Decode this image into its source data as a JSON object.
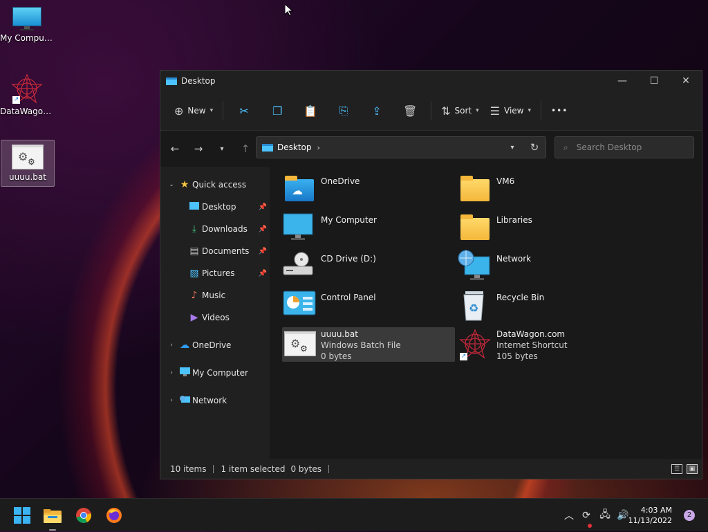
{
  "desktop": {
    "icons": [
      {
        "label": "My Computer",
        "icon": "monitor-icon"
      },
      {
        "label": "DataWagon...",
        "icon": "datawagon-icon"
      },
      {
        "label": "uuuu.bat",
        "icon": "batch-file-icon"
      }
    ]
  },
  "window": {
    "title": "Desktop",
    "toolbar": {
      "new_label": "New",
      "sort_label": "Sort",
      "view_label": "View",
      "more_label": "•••"
    },
    "address": {
      "location": "Desktop",
      "separator": "›"
    },
    "search": {
      "placeholder": "Search Desktop"
    },
    "sidebar": {
      "quick_access": "Quick access",
      "items": [
        {
          "label": "Desktop",
          "pinned": true
        },
        {
          "label": "Downloads",
          "pinned": true
        },
        {
          "label": "Documents",
          "pinned": true
        },
        {
          "label": "Pictures",
          "pinned": true
        },
        {
          "label": "Music",
          "pinned": false
        },
        {
          "label": "Videos",
          "pinned": false
        }
      ],
      "roots": [
        {
          "label": "OneDrive"
        },
        {
          "label": "My Computer"
        },
        {
          "label": "Network"
        }
      ]
    },
    "items": [
      {
        "name": "OneDrive",
        "icon": "onedrive-folder-icon"
      },
      {
        "name": "VM6",
        "icon": "folder-icon"
      },
      {
        "name": "My Computer",
        "icon": "monitor-icon"
      },
      {
        "name": "Libraries",
        "icon": "folder-icon"
      },
      {
        "name": "CD Drive (D:)",
        "icon": "cd-drive-icon"
      },
      {
        "name": "Network",
        "icon": "network-icon"
      },
      {
        "name": "Control Panel",
        "icon": "control-panel-icon"
      },
      {
        "name": "Recycle Bin",
        "icon": "recycle-bin-icon"
      },
      {
        "name": "uuuu.bat",
        "type": "Windows Batch File",
        "size": "0 bytes",
        "icon": "batch-file-icon",
        "selected": true
      },
      {
        "name": "DataWagon.com",
        "type": "Internet Shortcut",
        "size": "105 bytes",
        "icon": "datawagon-icon"
      }
    ],
    "status": {
      "count": "10 items",
      "selection": "1 item selected",
      "selection_size": "0 bytes"
    }
  },
  "taskbar": {
    "apps": [
      "start-icon",
      "file-explorer-icon",
      "chrome-icon",
      "firefox-icon"
    ],
    "time": "4:03 AM",
    "date": "11/13/2022",
    "notifications": "2"
  },
  "colors": {
    "window_bg": "#202020",
    "content_bg": "#191919",
    "accent": "#4cc2ff"
  }
}
